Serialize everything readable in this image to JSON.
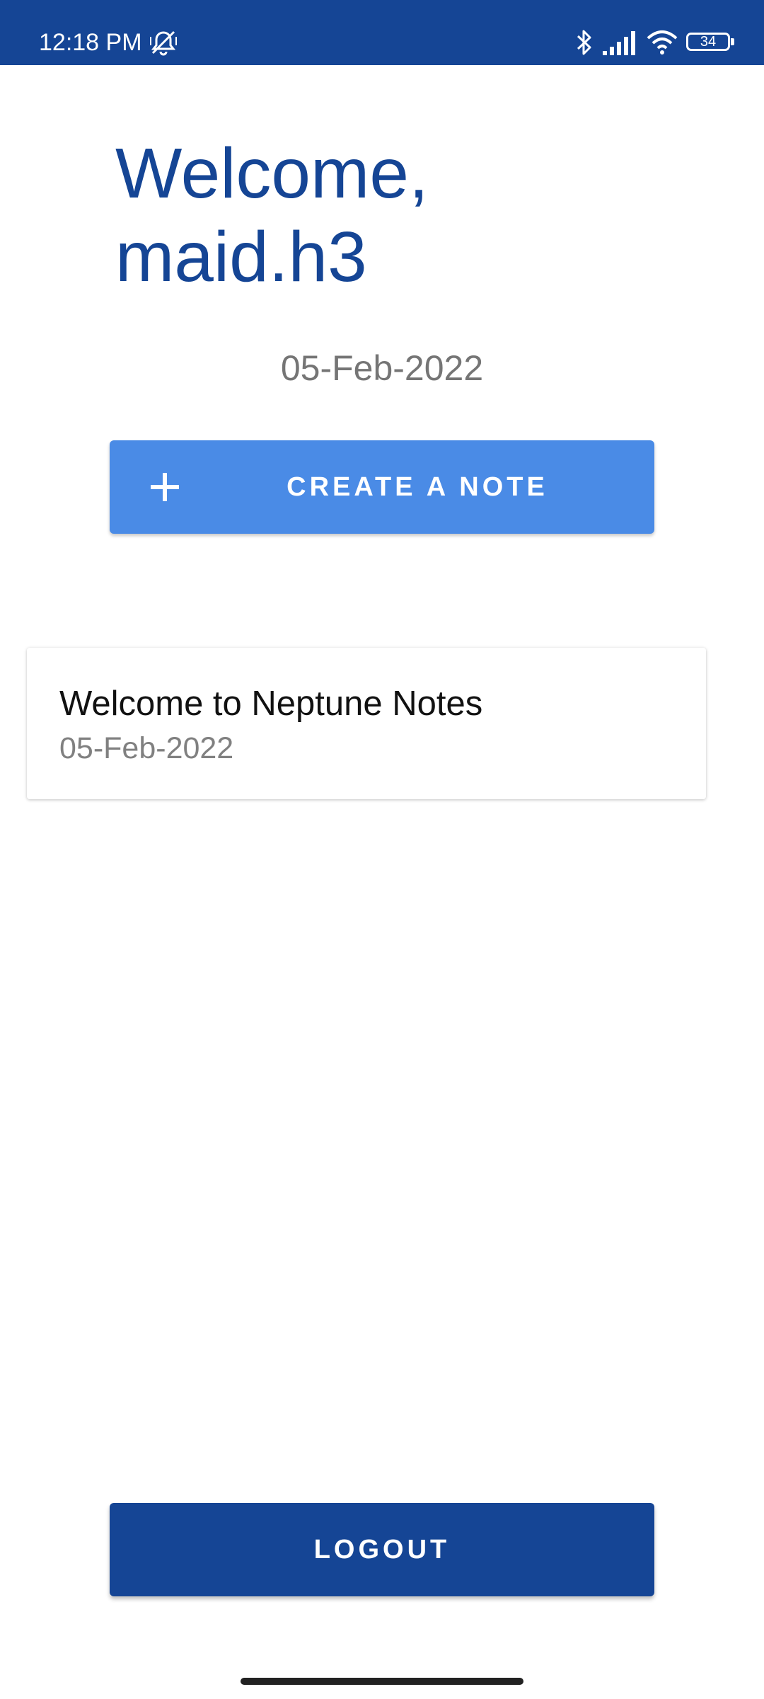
{
  "status_bar": {
    "time": "12:18 PM",
    "battery": "34",
    "icons": [
      "dnd-icon",
      "bluetooth-icon",
      "signal-icon",
      "wifi-icon",
      "battery-icon"
    ],
    "background_color": "#154595"
  },
  "header": {
    "welcome_title": "Welcome, maid.h3",
    "date": "05-Feb-2022"
  },
  "actions": {
    "create_label": "CREATE A NOTE",
    "create_icon": "plus-icon",
    "create_color": "#4a8be6",
    "logout_label": "LOGOUT",
    "logout_color": "#154595"
  },
  "notes": [
    {
      "title": "Welcome to Neptune Notes",
      "date": "05-Feb-2022"
    }
  ]
}
